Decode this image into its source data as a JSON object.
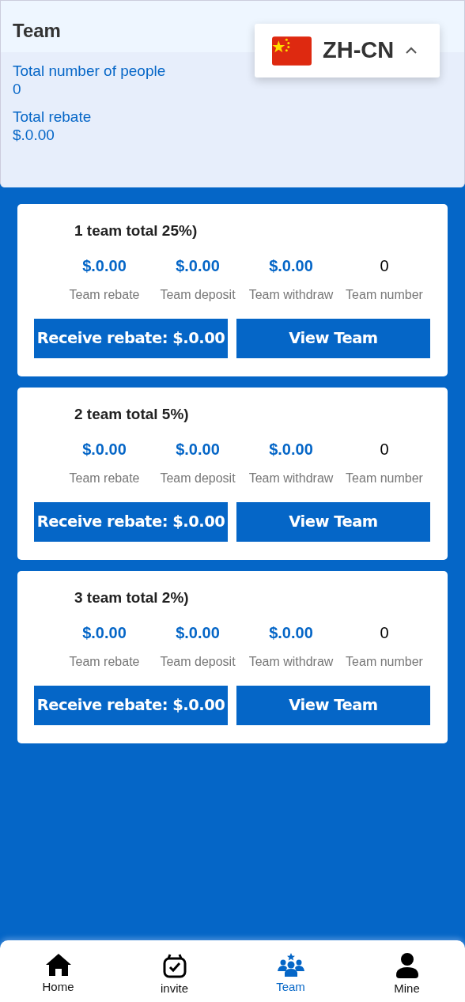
{
  "header": {
    "title": "Team",
    "summary": [
      {
        "label": "Total number of people",
        "value": "0"
      },
      {
        "label": "Total rebate",
        "value": "$.0.00"
      }
    ]
  },
  "language": {
    "code": "ZH-CN",
    "expanded": false
  },
  "teams": [
    {
      "title": "1 team total 25%)",
      "stats": [
        {
          "value": "$.0.00",
          "label": "Team rebate",
          "kind": "money"
        },
        {
          "value": "$.0.00",
          "label": "Team deposit",
          "kind": "money"
        },
        {
          "value": "$.0.00",
          "label": "Team withdraw",
          "kind": "money"
        },
        {
          "value": "0",
          "label": "Team number",
          "kind": "count"
        }
      ],
      "buttons": [
        "Receive rebate: $.0.00",
        "View Team"
      ]
    },
    {
      "title": "2 team total 5%)",
      "stats": [
        {
          "value": "$.0.00",
          "label": "Team rebate",
          "kind": "money"
        },
        {
          "value": "$.0.00",
          "label": "Team deposit",
          "kind": "money"
        },
        {
          "value": "$.0.00",
          "label": "Team withdraw",
          "kind": "money"
        },
        {
          "value": "0",
          "label": "Team number",
          "kind": "count"
        }
      ],
      "buttons": [
        "Receive rebate: $.0.00",
        "View Team"
      ]
    },
    {
      "title": "3 team total 2%)",
      "stats": [
        {
          "value": "$.0.00",
          "label": "Team rebate",
          "kind": "money"
        },
        {
          "value": "$.0.00",
          "label": "Team deposit",
          "kind": "money"
        },
        {
          "value": "$.0.00",
          "label": "Team withdraw",
          "kind": "money"
        },
        {
          "value": "0",
          "label": "Team number",
          "kind": "count"
        }
      ],
      "buttons": [
        "Receive rebate: $.0.00",
        "View Team"
      ]
    }
  ],
  "tab_bar": [
    {
      "label": "Home",
      "kind": "home",
      "selected": false
    },
    {
      "label": "invite",
      "kind": "invite",
      "selected": false
    },
    {
      "label": "Team",
      "kind": "team",
      "selected": true
    },
    {
      "label": "Mine",
      "kind": "mine",
      "selected": false
    }
  ]
}
